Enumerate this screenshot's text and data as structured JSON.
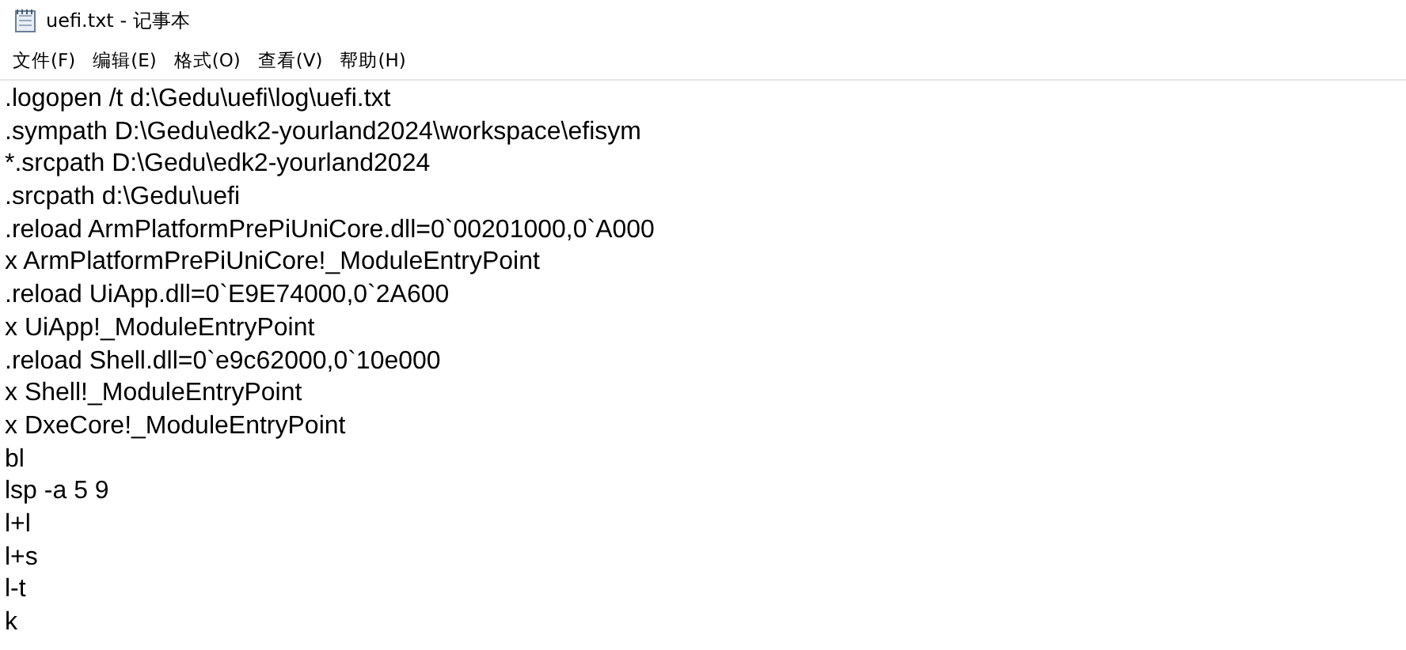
{
  "window": {
    "title": "uefi.txt - 记事本"
  },
  "menu": [
    "文件(F)",
    "编辑(E)",
    "格式(O)",
    "查看(V)",
    "帮助(H)"
  ],
  "editor": {
    "lines": [
      ".logopen /t d:\\Gedu\\uefi\\log\\uefi.txt",
      ".sympath D:\\Gedu\\edk2-yourland2024\\workspace\\efisym",
      "*.srcpath D:\\Gedu\\edk2-yourland2024",
      ".srcpath d:\\Gedu\\uefi",
      ".reload ArmPlatformPrePiUniCore.dll=0`00201000,0`A000",
      "x ArmPlatformPrePiUniCore!_ModuleEntryPoint",
      ".reload UiApp.dll=0`E9E74000,0`2A600",
      "x UiApp!_ModuleEntryPoint",
      ".reload Shell.dll=0`e9c62000,0`10e000",
      "x Shell!_ModuleEntryPoint",
      "x DxeCore!_ModuleEntryPoint",
      "bl",
      "lsp -a 5 9",
      "l+l",
      "l+s",
      "l-t",
      "k"
    ]
  }
}
